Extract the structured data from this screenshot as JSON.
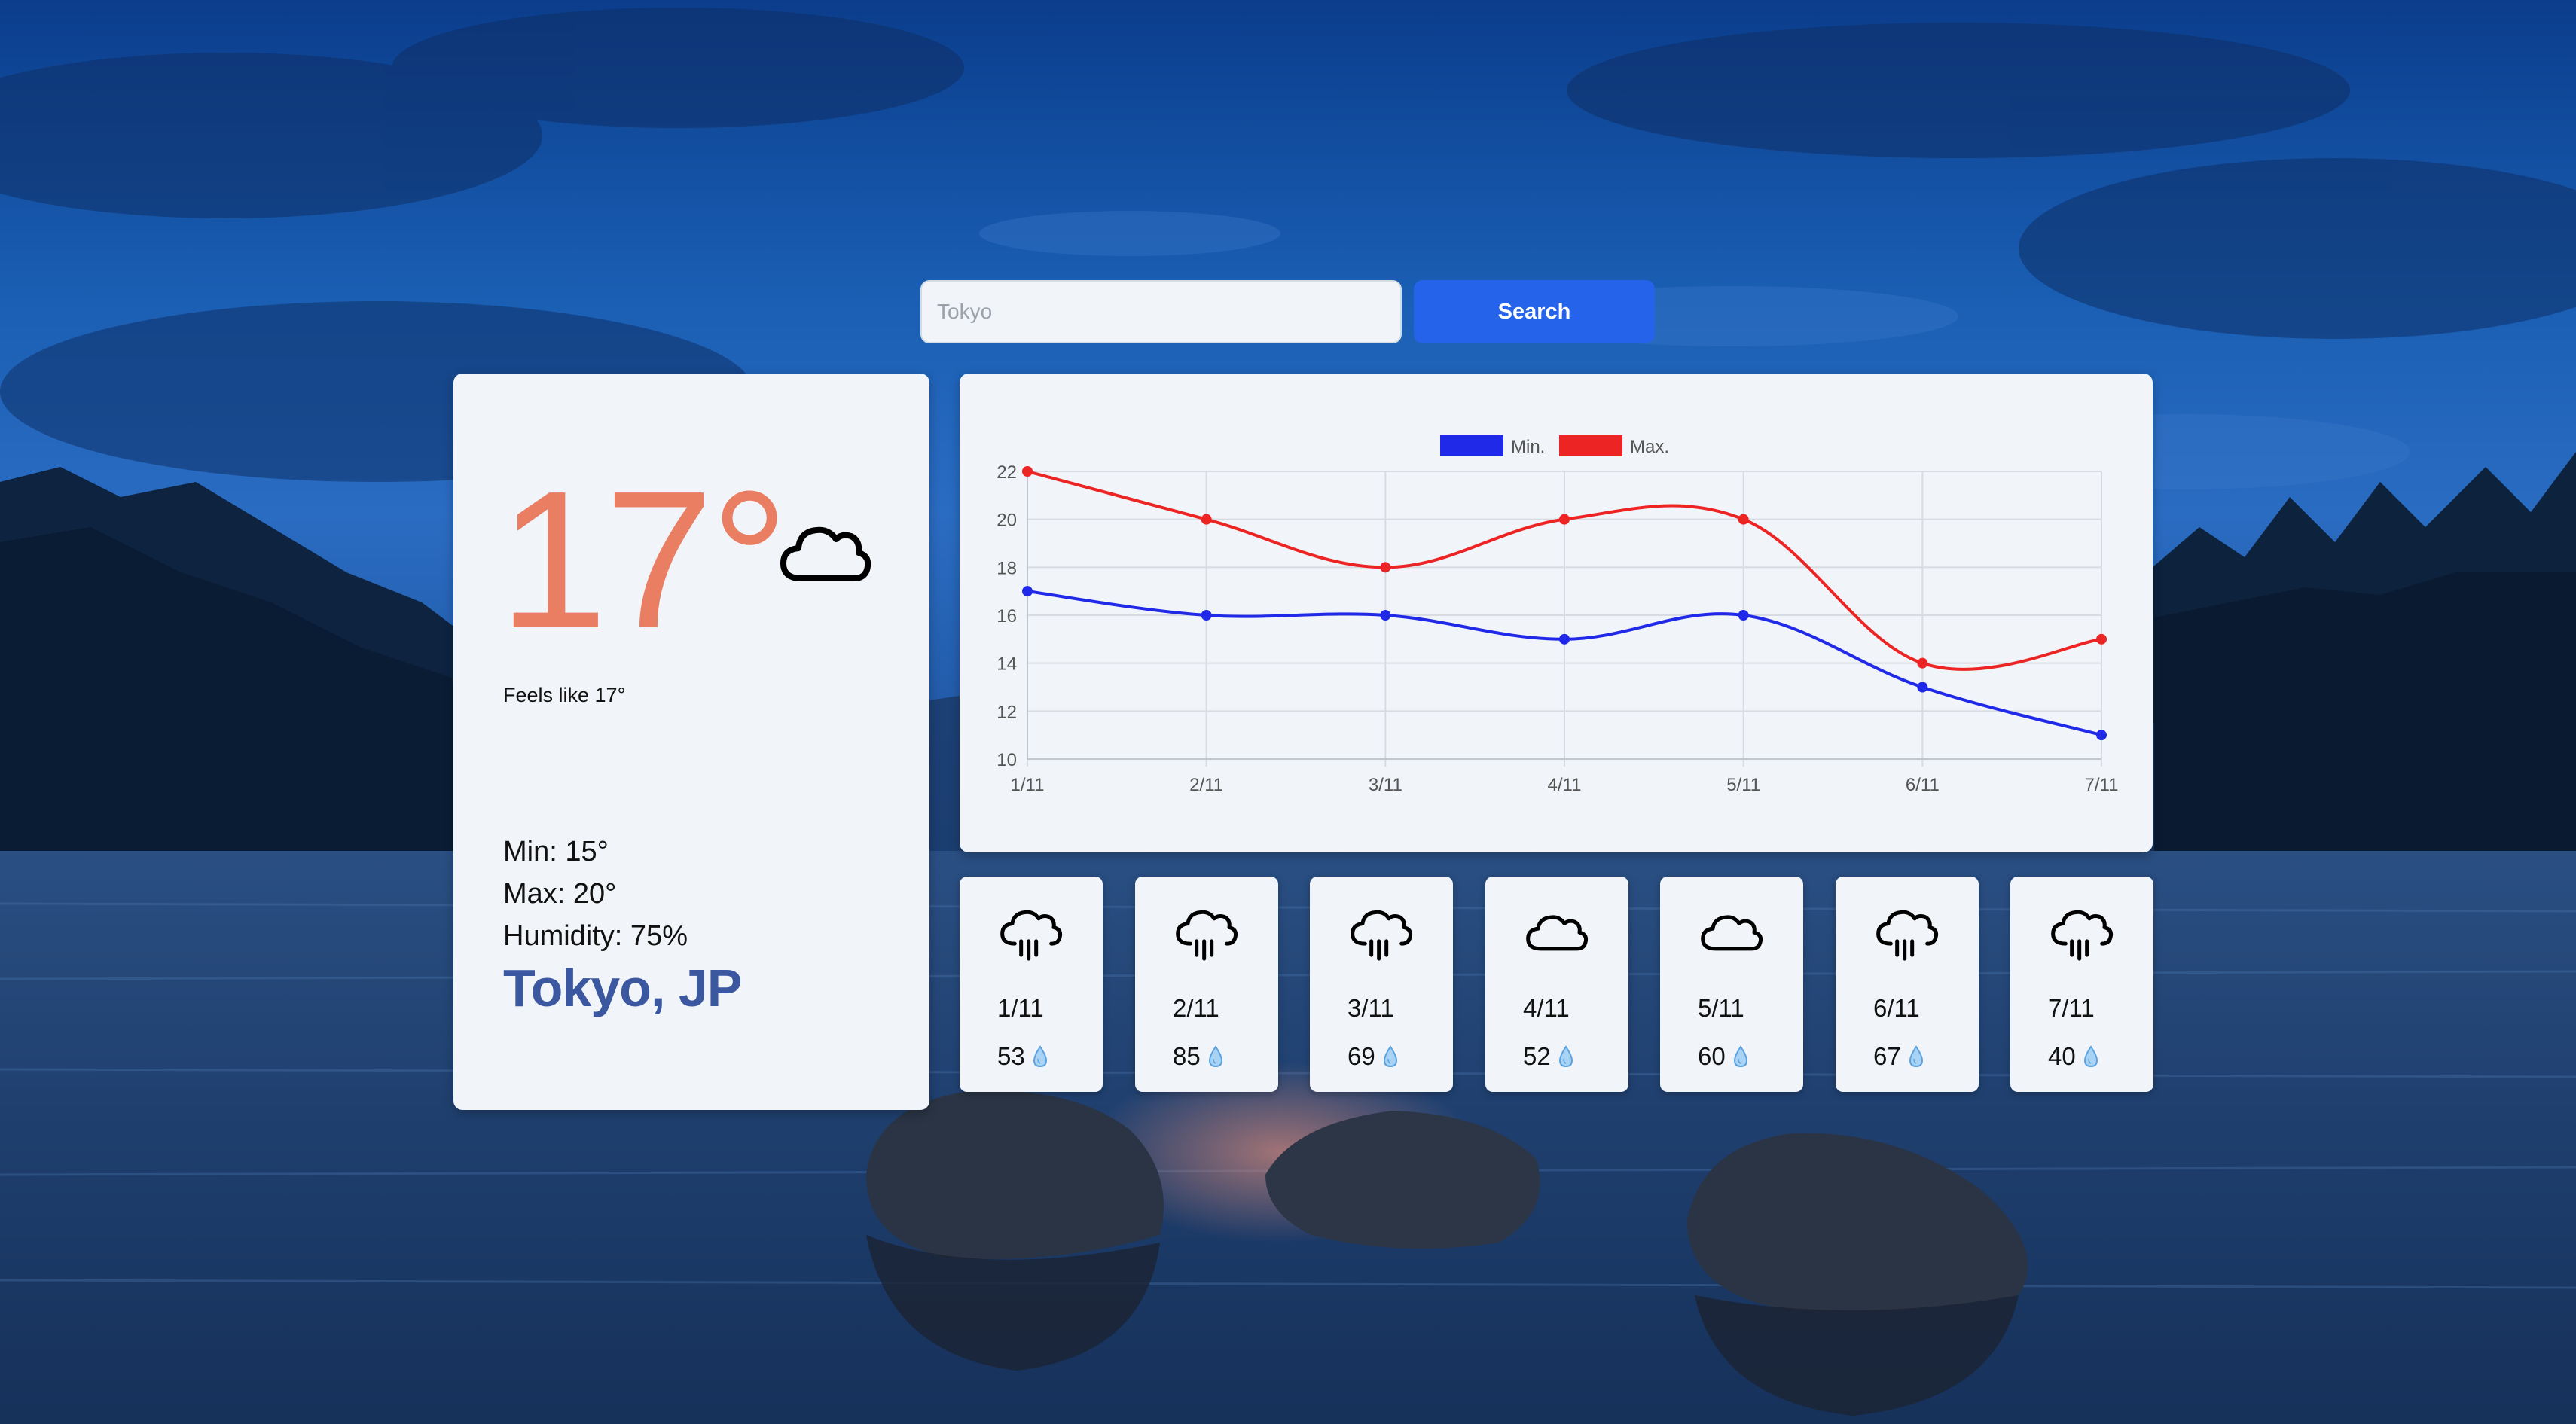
{
  "search": {
    "placeholder": "Tokyo",
    "value": "",
    "button_label": "Search"
  },
  "current": {
    "temperature": "17°",
    "icon": "cloud-icon",
    "feels_like": "Feels like 17°",
    "min": "Min: 15°",
    "max": "Max: 20°",
    "humidity": "Humidity: 75%",
    "city": "Tokyo, JP"
  },
  "colors": {
    "temp": "#e97e62",
    "city": "#3a57a0",
    "button": "#2563eb",
    "min_series": "#2029e8",
    "max_series": "#ec2424"
  },
  "chart_data": {
    "type": "line",
    "title": "",
    "xlabel": "",
    "ylabel": "",
    "categories": [
      "1/11",
      "2/11",
      "3/11",
      "4/11",
      "5/11",
      "6/11",
      "7/11"
    ],
    "series": [
      {
        "name": "Min.",
        "color": "#2029e8",
        "values": [
          17,
          16,
          16,
          15,
          16,
          13,
          11
        ]
      },
      {
        "name": "Max.",
        "color": "#ec2424",
        "values": [
          22,
          20,
          18,
          20,
          20,
          14,
          15
        ]
      }
    ],
    "ylim": [
      10,
      22
    ],
    "yticks": [
      10,
      12,
      14,
      16,
      18,
      20,
      22
    ],
    "grid": true,
    "legend_position": "top-center"
  },
  "forecast": [
    {
      "date": "1/11",
      "humidity": "53",
      "icon": "rain-cloud-icon"
    },
    {
      "date": "2/11",
      "humidity": "85",
      "icon": "rain-cloud-icon"
    },
    {
      "date": "3/11",
      "humidity": "69",
      "icon": "rain-cloud-icon"
    },
    {
      "date": "4/11",
      "humidity": "52",
      "icon": "cloud-icon"
    },
    {
      "date": "5/11",
      "humidity": "60",
      "icon": "cloud-icon"
    },
    {
      "date": "6/11",
      "humidity": "67",
      "icon": "rain-cloud-icon"
    },
    {
      "date": "7/11",
      "humidity": "40",
      "icon": "rain-cloud-icon"
    }
  ]
}
